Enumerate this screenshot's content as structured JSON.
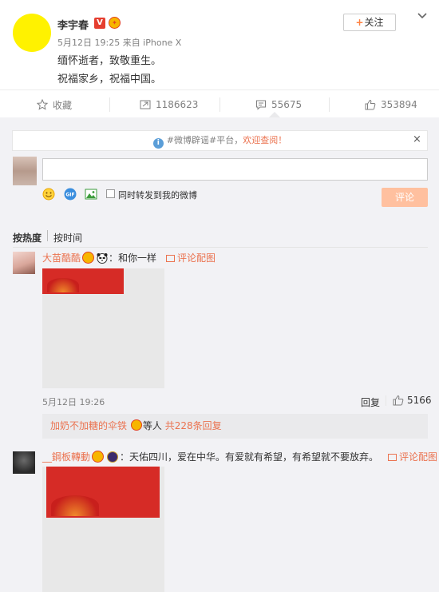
{
  "post": {
    "author": "李宇春",
    "verified_badge": "V",
    "meta": "5月12日 19:25 来自 iPhone X",
    "lines": [
      "缅怀逝者，致敬重生。",
      "祝福家乡，祝福中国。"
    ],
    "follow_label": "关注",
    "actions": {
      "favorite": "收藏",
      "forward_count": "1186623",
      "comment_count": "55675",
      "like_count": "353894"
    }
  },
  "comment_box": {
    "notice_prefix": "#微博辟谣#平台，",
    "notice_highlight": "欢迎查阅！",
    "notice_info_glyph": "i",
    "close_glyph": "×",
    "forward_label": "同时转发到我的微博",
    "submit_label": "评论",
    "gif_label": "GIF"
  },
  "sort": {
    "hot": "按热度",
    "time": "按时间"
  },
  "comments": [
    {
      "user": "大苗酷酷",
      "text": "：和你一样",
      "pic_link": "评论配图",
      "time": "5月12日 19:26",
      "reply_label": "回复",
      "likes": "5166",
      "replies": {
        "user": "加奶不加糖的伞铁",
        "middle": "等人",
        "count": "共228条回复"
      }
    },
    {
      "user": "__鋼板轉動",
      "text": "：天佑四川，爱在中华。有爱就有希望，有希望就不要放弃。",
      "pic_link": "评论配图"
    }
  ],
  "colors": {
    "accent": "#eb7350",
    "verified": "#e53e2f",
    "submit_disabled": "#ffc09f"
  }
}
